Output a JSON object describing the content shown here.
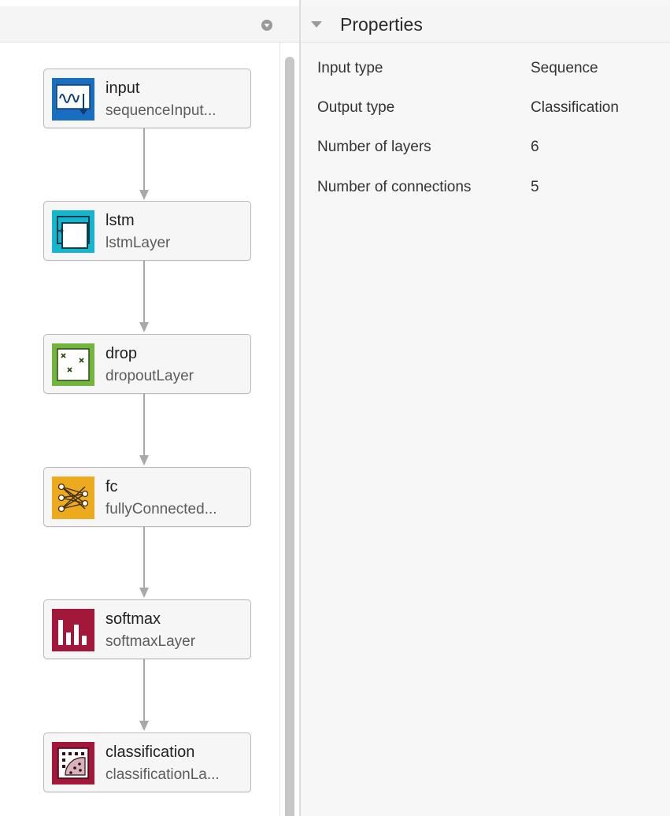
{
  "graph": {
    "layers": [
      {
        "name": "input",
        "type": "sequenceInput...",
        "icon": "sequence-input-icon",
        "color": "#1a6ec2"
      },
      {
        "name": "lstm",
        "type": "lstmLayer",
        "icon": "lstm-icon",
        "color": "#15b4cf"
      },
      {
        "name": "drop",
        "type": "dropoutLayer",
        "icon": "dropout-icon",
        "color": "#72b43e"
      },
      {
        "name": "fc",
        "type": "fullyConnected...",
        "icon": "fully-connected-icon",
        "color": "#eeaa1f"
      },
      {
        "name": "softmax",
        "type": "softmaxLayer",
        "icon": "softmax-icon",
        "color": "#a3173a"
      },
      {
        "name": "classification",
        "type": "classificationLa...",
        "icon": "classification-icon",
        "color": "#a3173a"
      }
    ]
  },
  "properties": {
    "title": "Properties",
    "rows": [
      {
        "label": "Input type",
        "value": "Sequence"
      },
      {
        "label": "Output type",
        "value": "Classification"
      },
      {
        "label": "Number of layers",
        "value": "6"
      },
      {
        "label": "Number of connections",
        "value": "5"
      }
    ]
  },
  "colors": {
    "node_border": "#b8b8b8",
    "connector": "#a8a8a8",
    "header_bg": "#f5f5f5"
  }
}
